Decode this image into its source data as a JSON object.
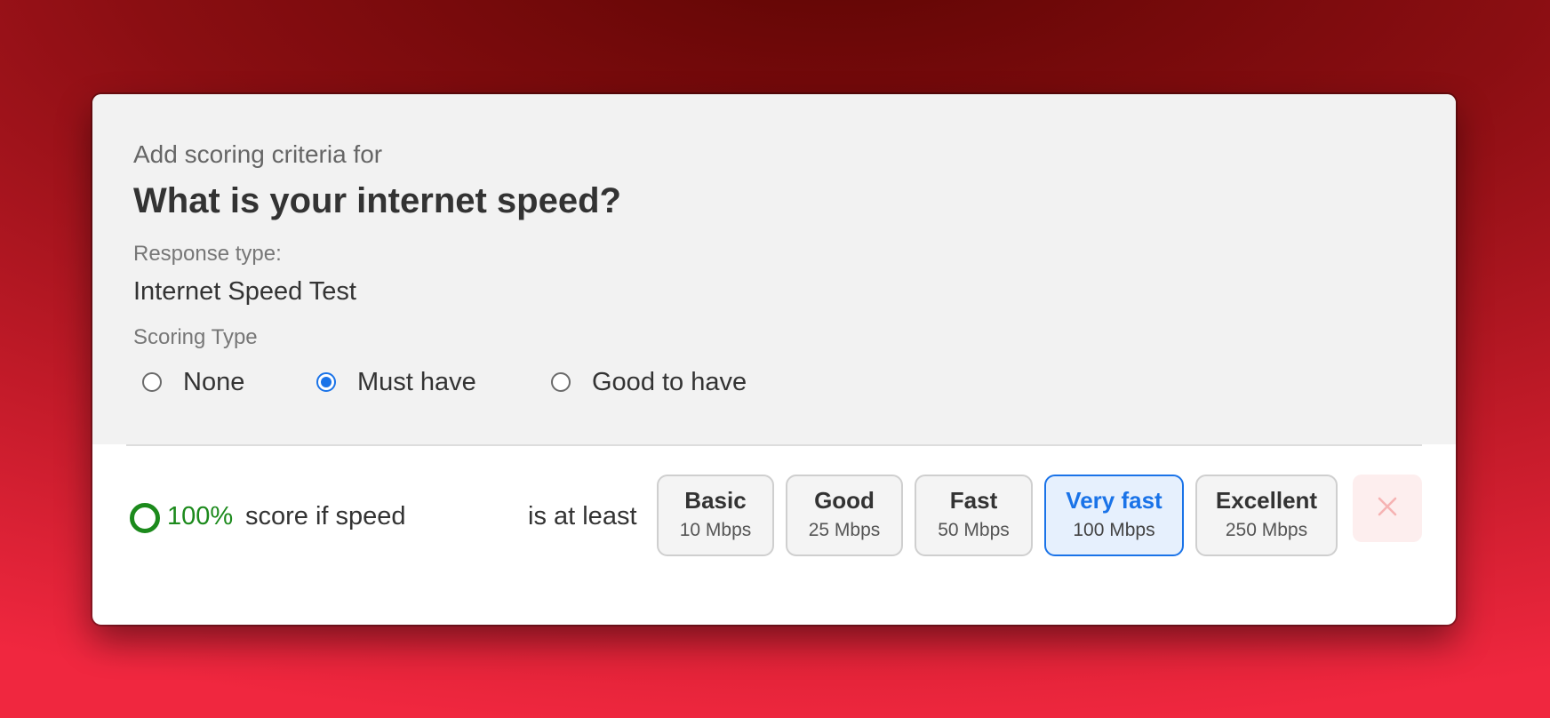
{
  "dialog": {
    "subtitle": "Add scoring criteria for",
    "question": "What is your internet speed?",
    "response_type_label": "Response type:",
    "response_type_value": "Internet Speed Test",
    "scoring_type_label": "Scoring Type",
    "scoring_options": [
      {
        "label": "None",
        "checked": false
      },
      {
        "label": "Must have",
        "checked": true
      },
      {
        "label": "Good to have",
        "checked": false
      }
    ]
  },
  "criteria": {
    "score_percent": "100%",
    "score_text": "score if speed",
    "comparator_text": "is at least",
    "speed_options": [
      {
        "name": "Basic",
        "speed": "10 Mbps",
        "selected": false
      },
      {
        "name": "Good",
        "speed": "25 Mbps",
        "selected": false
      },
      {
        "name": "Fast",
        "speed": "50 Mbps",
        "selected": false
      },
      {
        "name": "Very fast",
        "speed": "100 Mbps",
        "selected": true
      },
      {
        "name": "Excellent",
        "speed": "250 Mbps",
        "selected": false
      }
    ],
    "remove_icon": "close-icon"
  },
  "colors": {
    "accent": "#1a73e8",
    "success": "#1c8a1c",
    "remove": "#f6b3b3"
  }
}
